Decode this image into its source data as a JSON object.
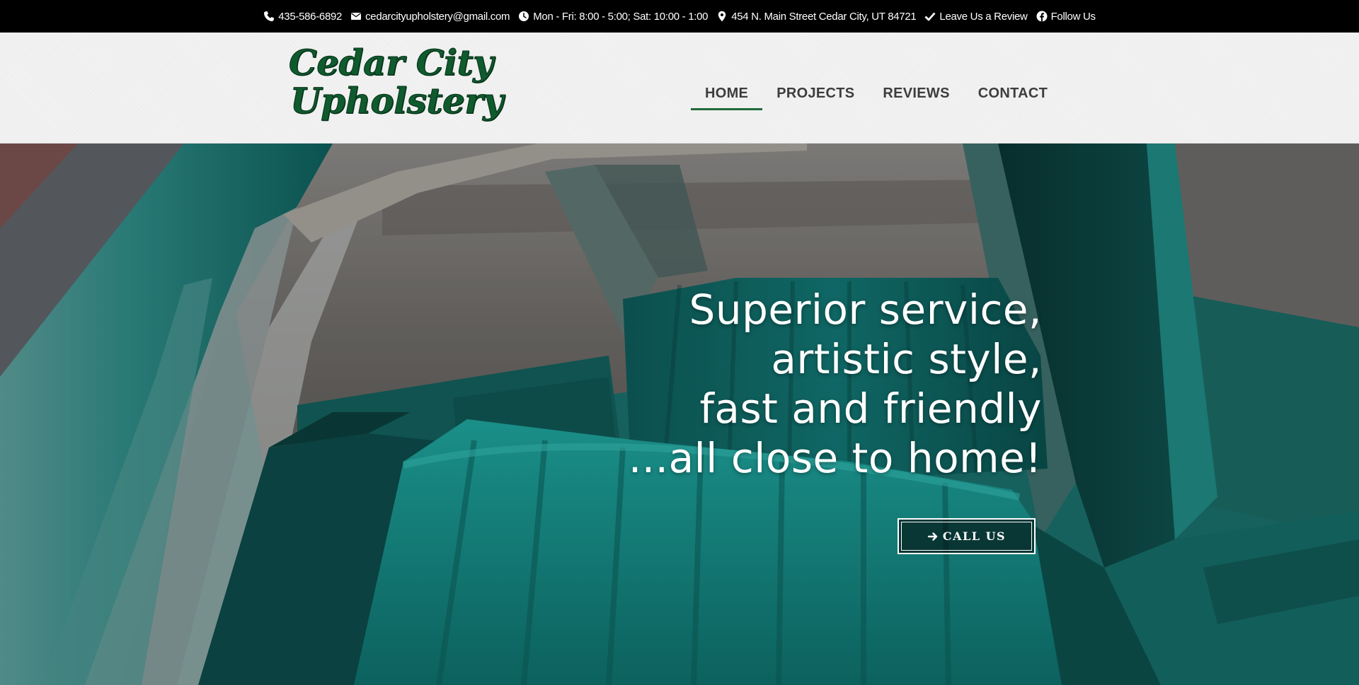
{
  "topbar": {
    "phone": "435-586-6892",
    "email": "cedarcityupholstery@gmail.com",
    "hours": "Mon - Fri: 8:00 - 5:00; Sat: 10:00 - 1:00",
    "address": "454 N. Main Street Cedar City, UT 84721",
    "review": "Leave Us a Review",
    "follow": "Follow Us"
  },
  "logo": {
    "line1": "Cedar City",
    "line2": "Upholstery"
  },
  "nav": {
    "items": [
      {
        "label": "HOME",
        "active": true
      },
      {
        "label": "PROJECTS",
        "active": false
      },
      {
        "label": "REVIEWS",
        "active": false
      },
      {
        "label": "CONTACT",
        "active": false
      }
    ]
  },
  "hero": {
    "headline": [
      "Superior service,",
      "artistic style,",
      "fast and friendly",
      "...all close to home!"
    ],
    "cta_label": "CALL US"
  },
  "colors": {
    "topbar_bg": "#000000",
    "brand_green": "#1f6b3a",
    "nav_text": "#3d3d3d",
    "seat_teal": "#1d8a86"
  },
  "icons": {
    "phone": "phone-icon",
    "email": "envelope-icon",
    "hours": "clock-icon",
    "address": "map-marker-icon",
    "review": "check-icon",
    "follow": "facebook-icon",
    "cta": "arrow-right-icon"
  }
}
